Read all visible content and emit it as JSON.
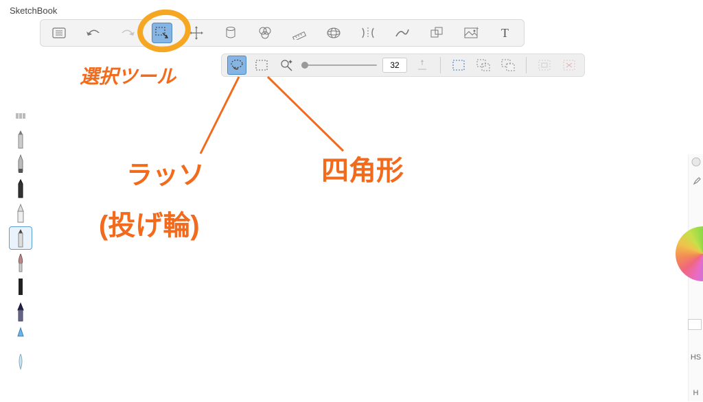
{
  "app": {
    "title": "SketchBook"
  },
  "mainToolbar": {
    "items": [
      {
        "name": "menu-icon"
      },
      {
        "name": "undo-icon"
      },
      {
        "name": "redo-icon"
      },
      {
        "name": "selection-tool-icon",
        "active": true
      },
      {
        "name": "transform-icon"
      },
      {
        "name": "fill-icon"
      },
      {
        "name": "guides-icon"
      },
      {
        "name": "ruler-icon"
      },
      {
        "name": "perspective-icon"
      },
      {
        "name": "symmetry-x-icon"
      },
      {
        "name": "stroke-stabilizer-icon"
      },
      {
        "name": "shapes-icon"
      },
      {
        "name": "image-icon"
      },
      {
        "name": "text-tool-icon"
      }
    ]
  },
  "subToolbar": {
    "lasso_active": true,
    "tolerance_value": "32"
  },
  "rightPanel": {
    "mode_label": "HS",
    "history_label": "H"
  },
  "annotations": {
    "selection_label": "選択ツール",
    "lasso_label": "ラッソ",
    "lasso_sub": "(投げ輪)",
    "rect_label": "四角形"
  }
}
